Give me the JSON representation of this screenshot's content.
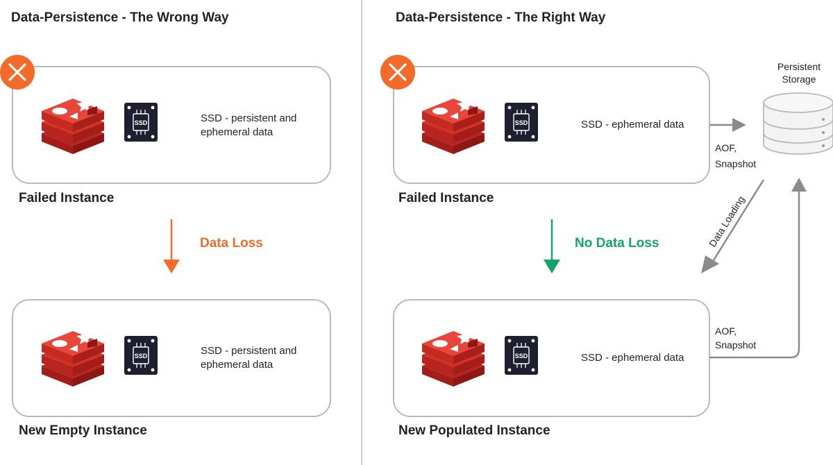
{
  "panels": {
    "left_title": "Data-Persistence - The Wrong Way",
    "right_title": "Data-Persistence - The Right Way"
  },
  "left": {
    "top_ssd_text": [
      "SSD - persistent and",
      "ephemeral data"
    ],
    "top_label": "Failed Instance",
    "transition_label": "Data Loss",
    "bottom_ssd_text": [
      "SSD - persistent and",
      "ephemeral data"
    ],
    "bottom_label": "New Empty Instance"
  },
  "right": {
    "top_ssd_text": "SSD - ephemeral data",
    "top_label": "Failed Instance",
    "transition_label": "No Data Loss",
    "bottom_ssd_text": "SSD - ephemeral data",
    "bottom_label": "New Populated Instance",
    "storage_label": [
      "Persistent",
      "Storage"
    ],
    "aof_top": [
      "AOF,",
      "Snapshot"
    ],
    "aof_bottom": [
      "AOF,",
      "Snapshot"
    ],
    "data_loading": "Data Loading"
  },
  "chip_label": "SSD",
  "colors": {
    "box_border": "#b9b9b9",
    "redis_red": "#d82c20",
    "fail_orange": "#f26b2b",
    "data_loss": "#f26b2b",
    "no_data_loss": "#16a36b",
    "arrow_grey": "#8a8a8a",
    "chip_dark": "#1e2030",
    "text": "#222222"
  },
  "icons": {
    "fail": "x-circle-icon",
    "redis": "redis-logo-icon",
    "ssd": "ssd-chip-icon",
    "storage": "database-icon"
  }
}
